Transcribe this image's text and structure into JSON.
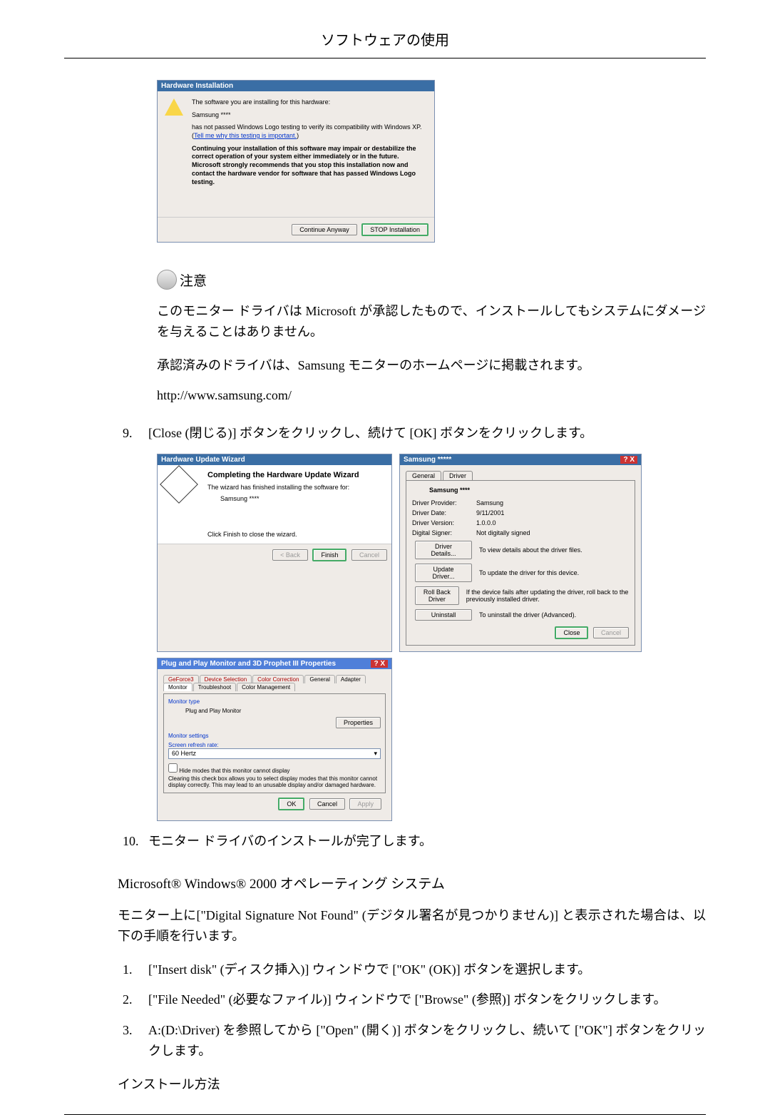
{
  "page_title": "ソフトウェアの使用",
  "hw_install": {
    "title": "Hardware Installation",
    "line1": "The software you are installing for this hardware:",
    "device": "Samsung ****",
    "line2a": "has not passed Windows Logo testing to verify its compatibility with Windows XP. (",
    "link": "Tell me why this testing is important.",
    "line2b": ")",
    "warning": "Continuing your installation of this software may impair or destabilize the correct operation of your system either immediately or in the future. Microsoft strongly recommends that you stop this installation now and contact the hardware vendor for software that has passed Windows Logo testing.",
    "btn_continue": "Continue Anyway",
    "btn_stop": "STOP Installation"
  },
  "note_label": "注意",
  "note_p1": "このモニター ドライバは Microsoft が承認したもので、インストールしてもシステムにダメージを与えることはありません。",
  "note_p2": "承認済みのドライバは、Samsung モニターのホームページに掲載されます。",
  "url": "http://www.samsung.com/",
  "step9_num": "9.",
  "step9": "[Close (閉じる)] ボタンをクリックし、続けて [OK] ボタンをクリックします。",
  "wizard": {
    "title": "Hardware Update Wizard",
    "heading": "Completing the Hardware Update Wizard",
    "line1": "The wizard has finished installing the software for:",
    "device": "Samsung ****",
    "line2": "Click Finish to close the wizard.",
    "back": "< Back",
    "finish": "Finish",
    "cancel": "Cancel"
  },
  "driver": {
    "title": "Samsung *****",
    "tab_general": "General",
    "tab_driver": "Driver",
    "device": "Samsung ****",
    "provider_l": "Driver Provider:",
    "provider_v": "Samsung",
    "date_l": "Driver Date:",
    "date_v": "9/11/2001",
    "version_l": "Driver Version:",
    "version_v": "1.0.0.0",
    "signer_l": "Digital Signer:",
    "signer_v": "Not digitally signed",
    "btn_details": "Driver Details...",
    "txt_details": "To view details about the driver files.",
    "btn_update": "Update Driver...",
    "txt_update": "To update the driver for this device.",
    "btn_rollback": "Roll Back Driver",
    "txt_rollback": "If the device fails after updating the driver, roll back to the previously installed driver.",
    "btn_uninstall": "Uninstall",
    "txt_uninstall": "To uninstall the driver (Advanced).",
    "close": "Close",
    "cancel": "Cancel"
  },
  "prop": {
    "title": "Plug and Play Monitor and 3D Prophet III Properties",
    "tabs": [
      "GeForce3",
      "Device Selection",
      "Color Correction",
      "General",
      "Adapter",
      "Monitor",
      "Troubleshoot",
      "Color Management"
    ],
    "mtype_l": "Monitor type",
    "mtype_v": "Plug and Play Monitor",
    "props_btn": "Properties",
    "msettings_l": "Monitor settings",
    "refresh_l": "Screen refresh rate:",
    "refresh_v": "60 Hertz",
    "hide_chk": "Hide modes that this monitor cannot display",
    "hide_txt": "Clearing this check box allows you to select display modes that this monitor cannot display correctly. This may lead to an unusable display and/or damaged hardware.",
    "ok": "OK",
    "cancel": "Cancel",
    "apply": "Apply"
  },
  "step10_num": "10.",
  "step10": "モニター ドライバのインストールが完了します。",
  "os_line": "Microsoft® Windows® 2000 オペレーティング システム",
  "condition": "モニター上に[\"Digital Signature Not Found\" (デジタル署名が見つかりません)] と表示された場合は、以下の手順を行います。",
  "step1_num": "1.",
  "step1": "[\"Insert disk\" (ディスク挿入)] ウィンドウで [\"OK\" (OK)] ボタンを選択します。",
  "step2_num": "2.",
  "step2": "[\"File Needed\" (必要なファイル)] ウィンドウで [\"Browse\" (参照)] ボタンをクリックします。",
  "step3_num": "3.",
  "step3": "A:(D:\\Driver) を参照してから [\"Open\" (開く)] ボタンをクリックし、続いて [\"OK\"] ボタンをクリックします。",
  "install_method": "インストール方法"
}
